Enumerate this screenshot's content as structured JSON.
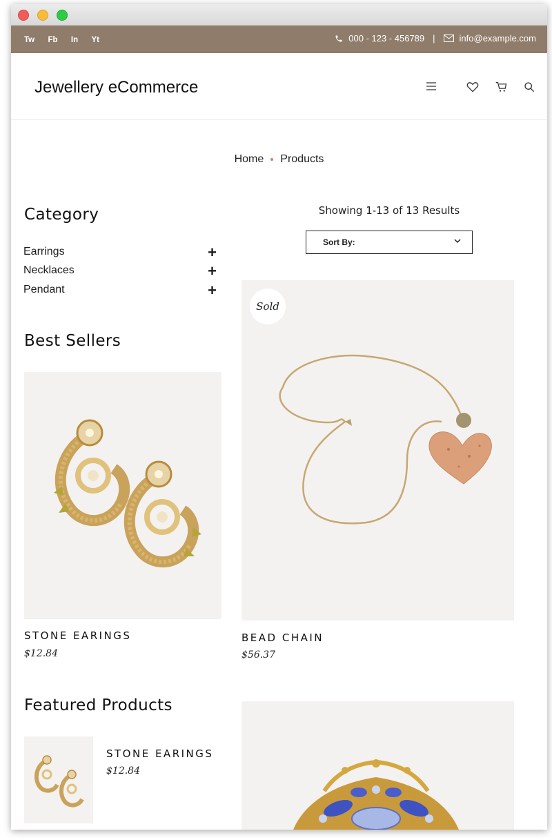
{
  "topbar": {
    "social": [
      "Tw",
      "Fb",
      "In",
      "Yt"
    ],
    "phone": "000 - 123 - 456789",
    "separator": "|",
    "email": "info@example.com"
  },
  "header": {
    "logo": "Jewellery eCommerce",
    "icons": [
      "menu-icon",
      "heart-icon",
      "cart-icon",
      "search-icon"
    ]
  },
  "breadcrumb": {
    "home": "Home",
    "current": "Products"
  },
  "sidebar": {
    "category_title": "Category",
    "categories": [
      {
        "label": "Earrings",
        "toggle": "+"
      },
      {
        "label": "Necklaces",
        "toggle": "+"
      },
      {
        "label": "Pendant",
        "toggle": "+"
      }
    ],
    "best_sellers_title": "Best Sellers",
    "best_seller": {
      "name": "STONE EARINGS",
      "price": "$12.84"
    },
    "featured_title": "Featured Products",
    "featured": {
      "name": "STONE EARINGS",
      "price": "$12.84"
    }
  },
  "main": {
    "results_text": "Showing 1-13 of 13 Results",
    "sort_label": "Sort By:",
    "products": [
      {
        "name": "BEAD CHAIN",
        "price": "$56.37",
        "badge": "Sold"
      }
    ]
  },
  "colors": {
    "topbar": "#907c6b",
    "accent": "#c8875e",
    "card_bg": "#f4f2f0"
  }
}
